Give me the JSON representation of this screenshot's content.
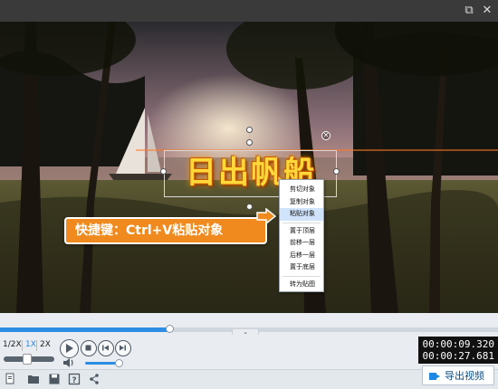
{
  "window": {
    "restore_icon": "⧉",
    "close_icon": "✕"
  },
  "video": {
    "title_text": "日出帆船",
    "close_glyph": "✕"
  },
  "tooltip": {
    "text": "快捷键：Ctrl+V粘贴对象"
  },
  "context_menu": {
    "items": [
      {
        "label": "剪切对象"
      },
      {
        "label": "复制对象"
      },
      {
        "label": "粘贴对象",
        "highlighted": true
      },
      {
        "label": "置于顶层"
      },
      {
        "label": "前移一层"
      },
      {
        "label": "后移一层"
      },
      {
        "label": "置于底层"
      },
      {
        "label": "转为贴图"
      }
    ]
  },
  "timeline": {
    "progress_fraction": 0.34,
    "collapse_glyph": "⌄"
  },
  "controls": {
    "speeds": [
      "1/2X",
      "1X",
      "2X"
    ],
    "active_speed": "1X",
    "volume_fraction": 1.0,
    "current_time": "00:00:09.320",
    "total_time": "00:00:27.681"
  },
  "toolbar": {
    "export_label": "导出视频"
  },
  "colors": {
    "accent": "#2c8de3",
    "tooltip_bg": "#f08a1f",
    "title_fill": "#ffd93a"
  }
}
